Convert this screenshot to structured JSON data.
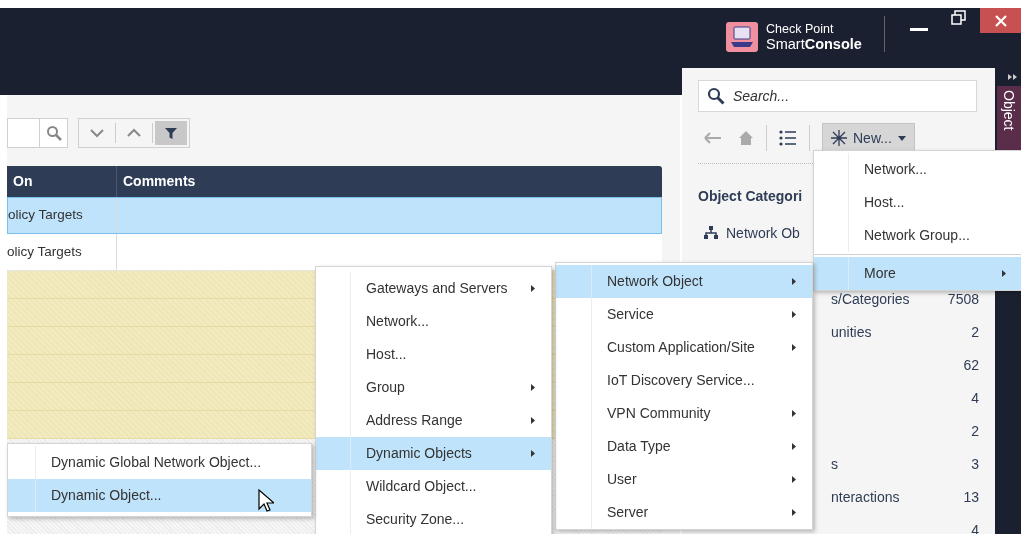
{
  "header": {
    "brand_line1": "Check Point",
    "brand_line2": "Smart**Console**"
  },
  "toolbar": {
    "buttons": [
      {
        "kind": "down",
        "selected": false
      },
      {
        "kind": "up",
        "selected": false
      },
      {
        "kind": "filter",
        "selected": true
      }
    ]
  },
  "table": {
    "columns": [
      "On",
      "Comments"
    ],
    "rows": [
      {
        "on": "olicy Targets",
        "selected": true
      },
      {
        "on": "olicy Targets",
        "selected": false
      }
    ]
  },
  "object_panel": {
    "search_placeholder": "Search...",
    "new_button": "New...",
    "heading": "Object Categori",
    "categories": [
      {
        "kind": "group",
        "label": "Network Ob"
      },
      {
        "kind": "item",
        "label": "s/Categories",
        "count": "7508"
      },
      {
        "kind": "item",
        "label": "unities",
        "count": "2"
      },
      {
        "kind": "item",
        "count": "62"
      },
      {
        "kind": "item",
        "count": "4"
      },
      {
        "kind": "item",
        "count": "2"
      },
      {
        "kind": "item",
        "label": "s",
        "count": "3"
      },
      {
        "kind": "item",
        "label": "nteractions",
        "count": "13"
      },
      {
        "kind": "item",
        "count": "4"
      }
    ]
  },
  "side_tab": "Object",
  "menus": [
    {
      "items": [
        {
          "label": "Network...",
          "has_submenu": false,
          "selected": false
        },
        {
          "label": "Host...",
          "has_submenu": false,
          "selected": false
        },
        {
          "label": "Network Group...",
          "has_submenu": false,
          "selected": false
        },
        {
          "label": "More",
          "has_submenu": true,
          "selected": true,
          "separator_before": true
        }
      ]
    },
    {
      "items": [
        {
          "label": "Network Object",
          "has_submenu": true,
          "selected": true
        },
        {
          "label": "Service",
          "has_submenu": true,
          "selected": false
        },
        {
          "label": "Custom Application/Site",
          "has_submenu": true,
          "selected": false
        },
        {
          "label": "IoT Discovery Service...",
          "has_submenu": false,
          "selected": false
        },
        {
          "label": "VPN Community",
          "has_submenu": true,
          "selected": false
        },
        {
          "label": "Data Type",
          "has_submenu": true,
          "selected": false
        },
        {
          "label": "User",
          "has_submenu": true,
          "selected": false
        },
        {
          "label": "Server",
          "has_submenu": true,
          "selected": false
        }
      ]
    },
    {
      "items": [
        {
          "label": "Gateways and Servers",
          "has_submenu": true,
          "selected": false
        },
        {
          "label": "Network...",
          "has_submenu": false,
          "selected": false
        },
        {
          "label": "Host...",
          "has_submenu": false,
          "selected": false
        },
        {
          "label": "Group",
          "has_submenu": true,
          "selected": false
        },
        {
          "label": "Address Range",
          "has_submenu": true,
          "selected": false
        },
        {
          "label": "Dynamic Objects",
          "has_submenu": true,
          "selected": true
        },
        {
          "label": "Wildcard Object...",
          "has_submenu": false,
          "selected": false
        },
        {
          "label": "Security Zone...",
          "has_submenu": false,
          "selected": false
        }
      ]
    },
    {
      "items": [
        {
          "label": "Dynamic Global Network Object...",
          "has_submenu": false,
          "selected": false
        },
        {
          "label": "Dynamic Object...",
          "has_submenu": false,
          "selected": true
        }
      ]
    }
  ]
}
